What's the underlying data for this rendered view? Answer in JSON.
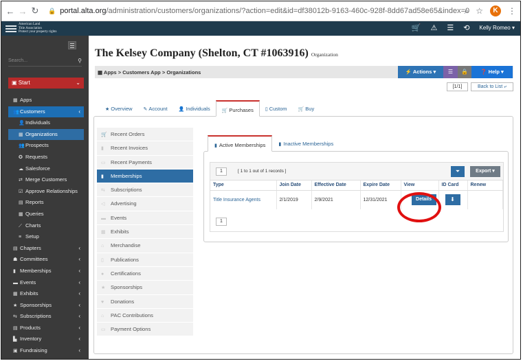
{
  "browser": {
    "url_host": "portal.alta.org",
    "url_path": "/administration/customers/organizations/?action=edit&id=df38012b-9163-460c-928f-8dd67ad58e65&index=0",
    "back_icon": "arrow-left-icon",
    "forward_icon": "arrow-right-icon",
    "reload_icon": "reload-icon",
    "profile_initial": "K"
  },
  "appbar": {
    "logo_line1": "American Land",
    "logo_line2": "Title Association",
    "logo_line3": "Protect your property rights",
    "user": "Kelly Romeo ▾"
  },
  "sidebar": {
    "search_placeholder": "Search...",
    "start_label": "Start",
    "items": [
      {
        "label": "Apps",
        "icon": "apps-icon",
        "level": 0
      },
      {
        "label": "Customers",
        "icon": "customers-icon",
        "level": 0,
        "state": "active",
        "chevron": "‹"
      },
      {
        "label": "Individuals",
        "icon": "user-icon",
        "level": 1
      },
      {
        "label": "Organizations",
        "icon": "building-icon",
        "level": 1,
        "state": "highlight"
      },
      {
        "label": "Prospects",
        "icon": "group-icon",
        "level": 1
      },
      {
        "label": "Requests",
        "icon": "request-icon",
        "level": 1
      },
      {
        "label": "Salesforce",
        "icon": "cloud-icon",
        "level": 1
      },
      {
        "label": "Merge Customers",
        "icon": "merge-icon",
        "level": 1
      },
      {
        "label": "Approve Relationships",
        "icon": "approve-icon",
        "level": 1
      },
      {
        "label": "Reports",
        "icon": "chart-icon",
        "level": 1
      },
      {
        "label": "Queries",
        "icon": "table-icon",
        "level": 1
      },
      {
        "label": "Charts",
        "icon": "line-chart-icon",
        "level": 1
      },
      {
        "label": "Setup",
        "icon": "list-icon",
        "level": 1
      },
      {
        "label": "Chapters",
        "icon": "chapters-icon",
        "level": 0,
        "chevron": "‹"
      },
      {
        "label": "Committees",
        "icon": "committees-icon",
        "level": 0,
        "chevron": "‹"
      },
      {
        "label": "Memberships",
        "icon": "bookmark-icon",
        "level": 0,
        "chevron": "‹"
      },
      {
        "label": "Events",
        "icon": "events-icon",
        "level": 0,
        "chevron": "‹"
      },
      {
        "label": "Exhibits",
        "icon": "exhibits-icon",
        "level": 0,
        "chevron": "‹"
      },
      {
        "label": "Sponsorships",
        "icon": "star-icon",
        "level": 0,
        "chevron": "‹"
      },
      {
        "label": "Subscriptions",
        "icon": "subscriptions-icon",
        "level": 0,
        "chevron": "‹"
      },
      {
        "label": "Products",
        "icon": "products-icon",
        "level": 0,
        "chevron": "‹"
      },
      {
        "label": "Inventory",
        "icon": "inventory-icon",
        "level": 0,
        "chevron": "‹"
      },
      {
        "label": "Fundraising",
        "icon": "fundraising-icon",
        "level": 0,
        "chevron": "‹"
      }
    ]
  },
  "page": {
    "title": "The Kelsey Company (Shelton, CT #1063916)",
    "subtitle": "Organization",
    "breadcrumb": "Apps  >  Customers App  >  Organizations",
    "actions_label": "Actions ▾",
    "help_label": "Help ▾",
    "pager": "[1/1]",
    "back_to_list": "Back to List"
  },
  "tabs": [
    {
      "label": "Overview",
      "icon": "star-icon"
    },
    {
      "label": "Account",
      "icon": "edit-icon"
    },
    {
      "label": "Individuals",
      "icon": "user-icon"
    },
    {
      "label": "Purchases",
      "icon": "cart-icon",
      "active": true
    },
    {
      "label": "Custom",
      "icon": "document-icon"
    },
    {
      "label": "Buy",
      "icon": "cart-icon"
    }
  ],
  "left_list": [
    {
      "label": "Recent Orders",
      "icon": "cart-icon"
    },
    {
      "label": "Recent Invoices",
      "icon": "invoice-icon"
    },
    {
      "label": "Recent Payments",
      "icon": "payment-icon"
    },
    {
      "label": "Memberships",
      "icon": "bookmark-icon",
      "active": true
    },
    {
      "label": "Subscriptions",
      "icon": "subscriptions-icon"
    },
    {
      "label": "Advertising",
      "icon": "megaphone-icon"
    },
    {
      "label": "Events",
      "icon": "events-icon"
    },
    {
      "label": "Exhibits",
      "icon": "exhibits-icon"
    },
    {
      "label": "Merchandise",
      "icon": "merchandise-icon"
    },
    {
      "label": "Publications",
      "icon": "publications-icon"
    },
    {
      "label": "Certifications",
      "icon": "certifications-icon"
    },
    {
      "label": "Sponsorships",
      "icon": "star-icon"
    },
    {
      "label": "Donations",
      "icon": "heart-icon"
    },
    {
      "label": "PAC Contributions",
      "icon": "pac-icon"
    },
    {
      "label": "Payment Options",
      "icon": "credit-card-icon"
    }
  ],
  "subtabs": [
    {
      "label": "Active Memberships",
      "active": true
    },
    {
      "label": "Inactive Memberships"
    }
  ],
  "grid": {
    "page_box": "1",
    "page_info": "[ 1 to 1 out of 1 records ]",
    "export_label": "Export ▾",
    "columns": [
      "Type",
      "Join Date",
      "Effective Date",
      "Expire Date",
      "View",
      "ID Card",
      "Renew"
    ],
    "rows": [
      {
        "type": "Title Insurance Agents",
        "join_date": "2/1/2019",
        "effective_date": "2/9/2021",
        "expire_date": "12/31/2021",
        "view": "Details"
      }
    ],
    "bottom_page": "1"
  }
}
